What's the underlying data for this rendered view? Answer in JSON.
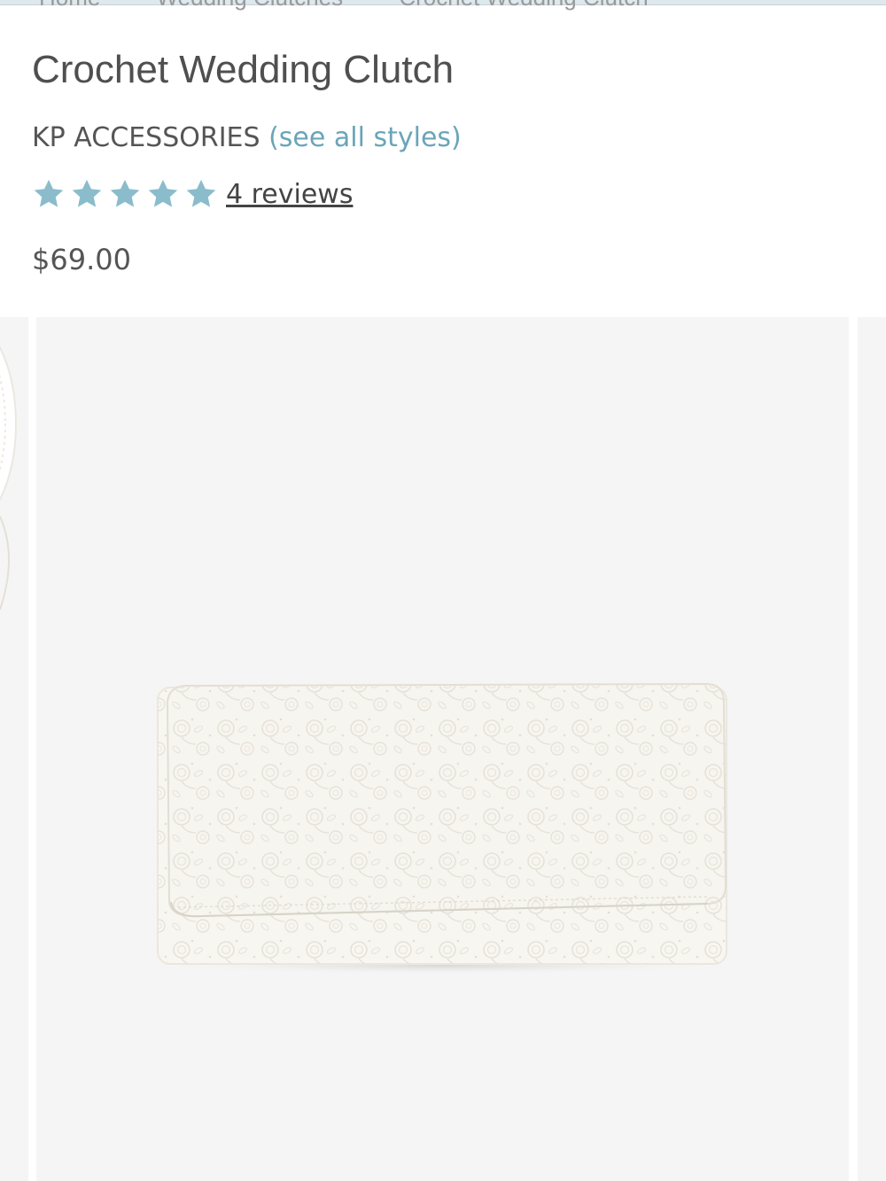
{
  "breadcrumb": [
    "Home",
    "Wedding Clutches",
    "Crochet Wedding Clutch"
  ],
  "product": {
    "title": "Crochet Wedding Clutch",
    "brand": "KP ACCESSORIES",
    "see_all": "(see all styles)",
    "rating": 5,
    "reviews_label": "4 reviews",
    "price": "$69.00"
  },
  "colors": {
    "star": "#8bbccb",
    "link": "#6aa5b8",
    "image_background": "#f5f5f5"
  },
  "icons": [
    "star-icon"
  ]
}
